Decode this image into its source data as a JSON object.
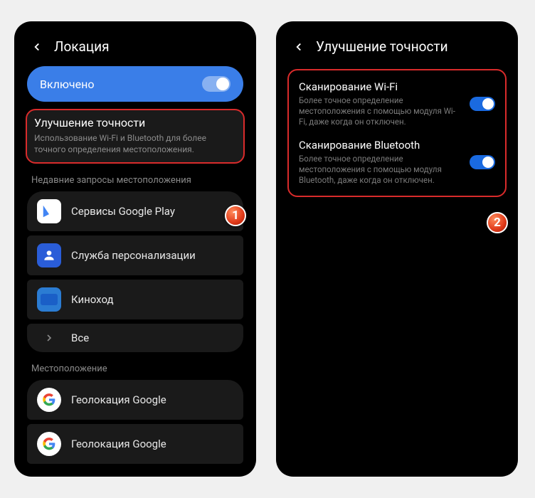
{
  "left": {
    "header_title": "Локация",
    "enabled_label": "Включено",
    "accuracy": {
      "title": "Улучшение точности",
      "desc": "Использование Wi-Fi и Bluetooth для более точного определения местоположения."
    },
    "recent_header": "Недавние запросы местоположения",
    "apps": [
      "Сервисы Google Play",
      "Служба персонализации",
      "Киноход",
      "Все"
    ],
    "location_header": "Местоположение",
    "location_items": [
      "Геолокация Google",
      "Геолокация Google"
    ],
    "badge": "1"
  },
  "right": {
    "header_title": "Улучшение точности",
    "wifi": {
      "title": "Сканирование Wi-Fi",
      "desc": "Более точное определение местоположения с помощью модуля Wi-Fi, даже когда он отключен."
    },
    "bluetooth": {
      "title": "Сканирование Bluetooth",
      "desc": "Более точное определение местоположения с помощью модуля Bluetooth, даже когда он отключен."
    },
    "badge": "2"
  }
}
